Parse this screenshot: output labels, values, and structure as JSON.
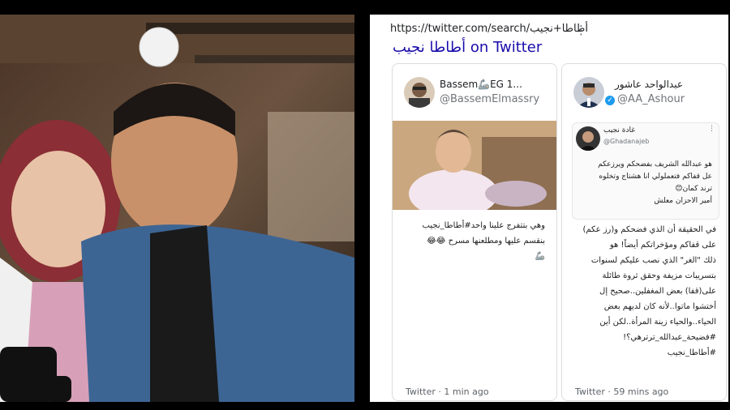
{
  "url": "https://twitter.com/search/أطاطا+نجيب",
  "more_icon": "⋮",
  "search_title": "أطاطا نجيب on Twitter",
  "tweets": [
    {
      "name": "Bassem🦾EG 1...",
      "handle": "@BassemElmassry",
      "text": "وهي بتتفرج علينا واحد#أطاطا_نجيب\nبنقسم عليها ومطلعنها مسرح 😂😂\n🦾",
      "footer": "Twitter · 1 min ago"
    },
    {
      "name": "عبدالواحد عاشور",
      "handle": "@AA_Ashour",
      "verified_icon": "✓",
      "text": "في الحقيقة أن الذي فضحكم و(رز عكم)\nعلى قفاكم ومؤخراتكم أيضاً! هو\nذلك \"الغر\" الذي نصب عليكم لسنوات\nبتسريبات مزيفة وحقق ثروة طائلة\nعلى(قفا) بعض المغفلين..صحيح إل\nأختشوا ماتوا..لأنه كان لديهم بعض\nالحياء..والحياء زينة المرأة..لكن أين\n#فضيحة_عبدالله_ترترهي؟!\n#أطاطا_نجيب",
      "footer": "Twitter · 59 mins ago",
      "quoted": {
        "name": "غادة نجيب",
        "handle": "@Ghadanajeb",
        "text": "هو عبدالله الشريف بفضحكم ويرزعكم\nعل قفاكم فتعملولي انا هشتاج وتخلوه\nترند كمان😊\nأمير الاحزان معلش"
      }
    }
  ],
  "colors": {
    "link": "#1a0dab",
    "verified": "#1d9bf0",
    "border": "#dadce0"
  }
}
